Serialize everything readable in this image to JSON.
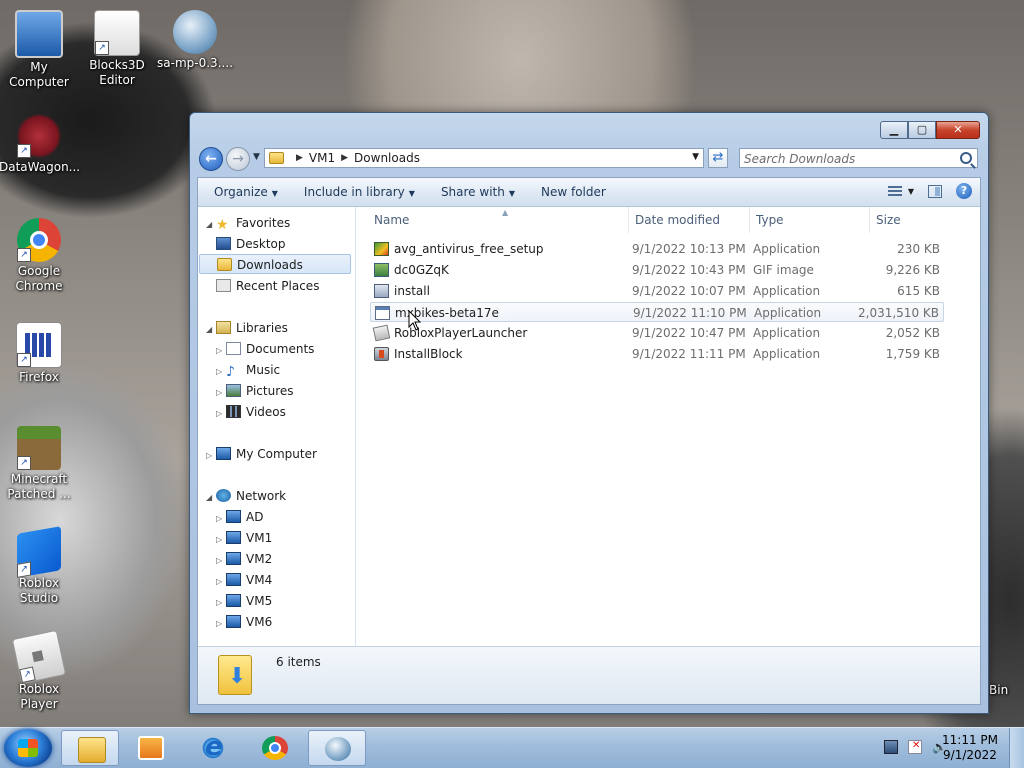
{
  "desktop": {
    "icons": [
      {
        "label": "My Computer"
      },
      {
        "label": "Blocks3D Editor"
      },
      {
        "label": "sa-mp-0.3...."
      },
      {
        "label": "DataWagon..."
      },
      {
        "label": "Google Chrome"
      },
      {
        "label": "Firefox"
      },
      {
        "label": "Minecraft Patched ..."
      },
      {
        "label": "Roblox Studio"
      },
      {
        "label": "Roblox Player"
      }
    ],
    "partial_label": "Bin"
  },
  "explorer": {
    "address": {
      "crumbs": [
        "VM1",
        "Downloads"
      ]
    },
    "search": {
      "placeholder": "Search Downloads"
    },
    "toolbar": {
      "organize": "Organize",
      "include_in_library": "Include in library",
      "share_with": "Share with",
      "new_folder": "New folder"
    },
    "nav": {
      "favorites": "Favorites",
      "desktop": "Desktop",
      "downloads": "Downloads",
      "recent_places": "Recent Places",
      "libraries": "Libraries",
      "documents": "Documents",
      "music": "Music",
      "pictures": "Pictures",
      "videos": "Videos",
      "my_computer": "My Computer",
      "network": "Network",
      "hosts": [
        "AD",
        "VM1",
        "VM2",
        "VM4",
        "VM5",
        "VM6"
      ]
    },
    "columns": {
      "name": "Name",
      "date_modified": "Date modified",
      "type": "Type",
      "size": "Size"
    },
    "files": [
      {
        "name": "avg_antivirus_free_setup",
        "date": "9/1/2022 10:13 PM",
        "type": "Application",
        "size": "230 KB",
        "icon": "avg-icon"
      },
      {
        "name": "dc0GZqK",
        "date": "9/1/2022 10:43 PM",
        "type": "GIF image",
        "size": "9,226 KB",
        "icon": "gif-icon"
      },
      {
        "name": "install",
        "date": "9/1/2022 10:07 PM",
        "type": "Application",
        "size": "615 KB",
        "icon": "installer-icon"
      },
      {
        "name": "mxbikes-beta17e",
        "date": "9/1/2022 11:10 PM",
        "type": "Application",
        "size": "2,031,510 KB",
        "icon": "application-icon"
      },
      {
        "name": "RobloxPlayerLauncher",
        "date": "9/1/2022 10:47 PM",
        "type": "Application",
        "size": "2,052 KB",
        "icon": "roblox-icon"
      },
      {
        "name": "InstallBlock",
        "date": "9/1/2022 11:11 PM",
        "type": "Application",
        "size": "1,759 KB",
        "icon": "installblock-icon"
      }
    ],
    "status": {
      "item_count": "6 items"
    }
  },
  "taskbar": {
    "clock_time": "11:11 PM",
    "clock_date": "9/1/2022"
  },
  "colors": {
    "taskbar": "#9fbcdb",
    "window_frame": "#b6cce6",
    "selection": "#d6e6f8"
  }
}
